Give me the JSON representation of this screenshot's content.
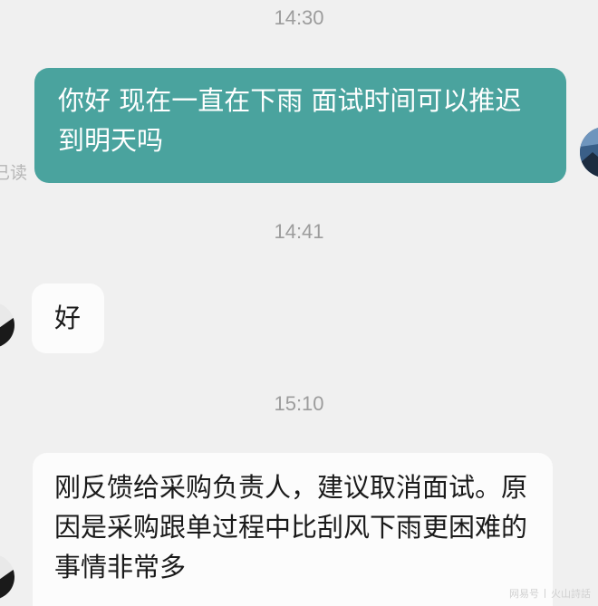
{
  "conversation": {
    "messages": [
      {
        "timestamp": "14:30",
        "direction": "outgoing",
        "text": "你好  现在一直在下雨  面试时间可以推迟到明天吗",
        "status": "已读"
      },
      {
        "timestamp": "14:41",
        "direction": "incoming",
        "text": "好"
      },
      {
        "timestamp": "15:10",
        "direction": "incoming",
        "text": "刚反馈给采购负责人，建议取消面试。原因是采购跟单过程中比刮风下雨更困难的事情非常多"
      }
    ]
  },
  "watermark": {
    "left": "网易号",
    "right": "火山詩話"
  },
  "colors": {
    "background": "#f0f0f0",
    "outgoing_bubble": "#4aa39e",
    "incoming_bubble": "#fcfcfc",
    "timestamp_text": "#9c9c9c"
  }
}
